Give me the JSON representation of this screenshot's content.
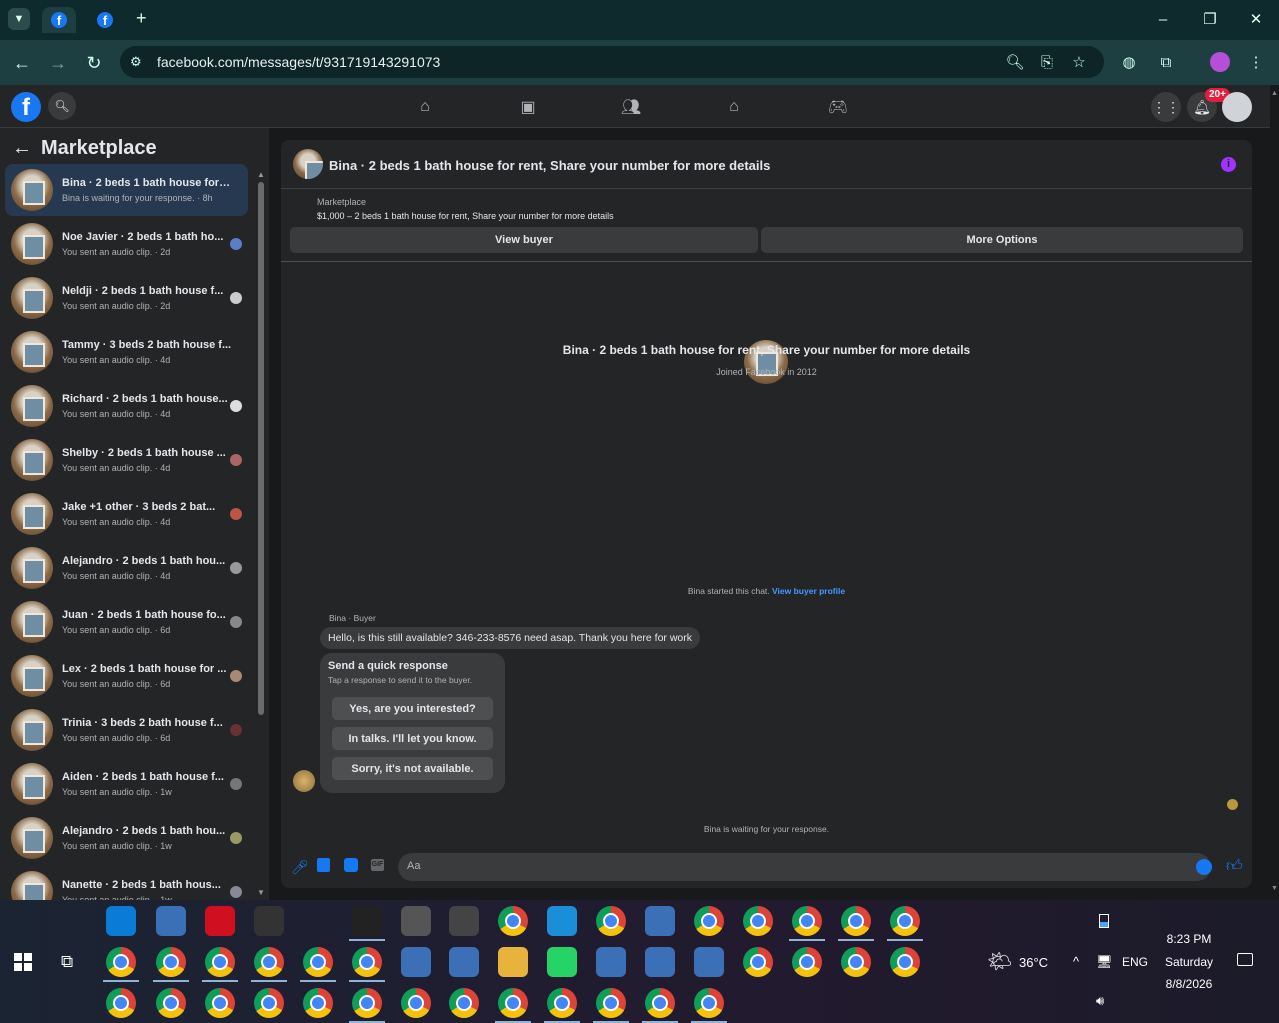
{
  "browser": {
    "url": "facebook.com/messages/t/931719143291073",
    "new_tab": "+",
    "window_controls": [
      "–",
      "❐",
      "✕"
    ]
  },
  "fb_header": {
    "notification_badge": "20+"
  },
  "sidebar": {
    "title": "Marketplace",
    "conversations": [
      {
        "title": "Bina · 2 beds 1 bath house for r...",
        "subtitle": "Bina is waiting for your response. · 8h",
        "selected": true
      },
      {
        "title": "Noe Javier · 2 beds 1 bath ho...",
        "subtitle": "You sent an audio clip. · 2d"
      },
      {
        "title": "Neldji · 2 beds 1 bath house f...",
        "subtitle": "You sent an audio clip. · 2d"
      },
      {
        "title": "Tammy · 3 beds 2 bath house f...",
        "subtitle": "You sent an audio clip. · 4d"
      },
      {
        "title": "Richard · 2 beds 1 bath house...",
        "subtitle": "You sent an audio clip. · 4d"
      },
      {
        "title": "Shelby · 2 beds 1 bath house ...",
        "subtitle": "You sent an audio clip. · 4d"
      },
      {
        "title": "Jake +1 other · 3 beds 2 bat...",
        "subtitle": "You sent an audio clip. · 4d"
      },
      {
        "title": "Alejandro · 2 beds 1 bath hou...",
        "subtitle": "You sent an audio clip. · 4d"
      },
      {
        "title": "Juan · 2 beds 1 bath house fo...",
        "subtitle": "You sent an audio clip. · 6d"
      },
      {
        "title": "Lex · 2 beds 1 bath house for ...",
        "subtitle": "You sent an audio clip. · 6d"
      },
      {
        "title": "Trinia · 3 beds 2 bath house f...",
        "subtitle": "You sent an audio clip. · 6d"
      },
      {
        "title": "Aiden · 2 beds 1 bath house f...",
        "subtitle": "You sent an audio clip. · 1w"
      },
      {
        "title": "Alejandro · 2 beds 1 bath hou...",
        "subtitle": "You sent an audio clip. · 1w"
      },
      {
        "title": "Nanette · 2 beds 1 bath hous...",
        "subtitle": "You sent an audio clip. · 1w"
      }
    ]
  },
  "chat": {
    "header_title": "Bina · 2 beds 1 bath house for rent, Share your number for more details",
    "listing_source": "Marketplace",
    "listing_text": "$1,000 – 2 beds 1 bath house for rent, Share your number for more details",
    "view_buyer": "View buyer",
    "more_options": "More Options",
    "profile_name": "Bina · 2 beds 1 bath house for rent, Share your number for more details",
    "profile_joined": "Joined Facebook in 2012",
    "started_text": "Bina started this chat.",
    "view_buyer_profile": "View buyer profile",
    "sender_label": "Bina · Buyer",
    "message": "Hello, is this still available? 346-233-8576 need asap. Thank you here for work",
    "quick_title": "Send a quick response",
    "quick_sub": "Tap a response to send it to the buyer.",
    "quick_replies": [
      "Yes, are you interested?",
      "In talks. I'll let you know.",
      "Sorry, it's not available."
    ],
    "waiting_text": "Bina is waiting for your response.",
    "composer_placeholder": "Aa"
  },
  "system_tray": {
    "temperature": "36°C",
    "language": "ENG",
    "time": "8:23 PM",
    "day": "Saturday",
    "date": "8/8/2026"
  },
  "colors": {
    "accent": "#1877f2",
    "link": "#4599ff",
    "badge": "#e41e3f",
    "selected_row": "#263951"
  }
}
